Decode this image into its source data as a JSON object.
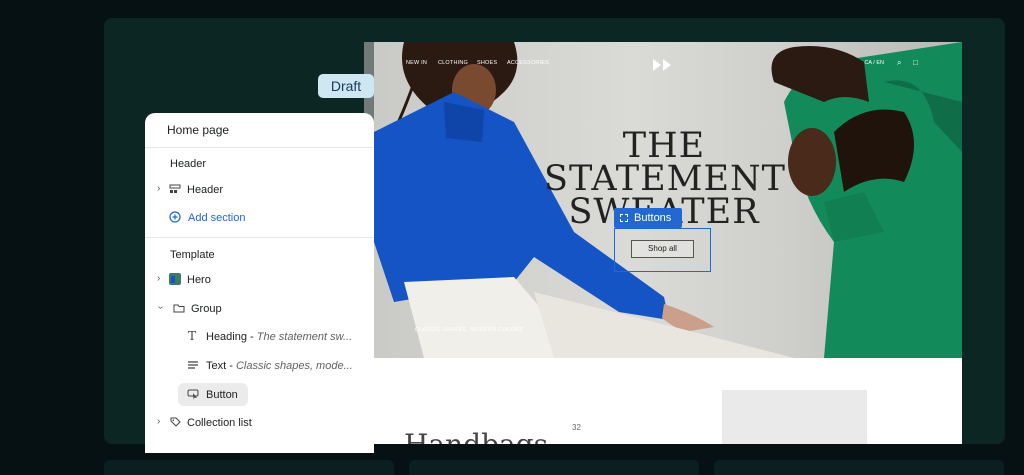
{
  "draft_label": "Draft",
  "sidebar": {
    "title": "Home page",
    "header_section": "Header",
    "header_item": "Header",
    "add_section": "Add section",
    "template_section": "Template",
    "hero": "Hero",
    "group": "Group",
    "heading_label": "Heading -",
    "heading_detail": "The statement sw...",
    "text_label": "Text -",
    "text_detail": "Classic shapes, mode...",
    "button": "Button",
    "collection_list": "Collection list"
  },
  "preview": {
    "nav": [
      "NEW IN",
      "CLOTHING",
      "SHOES",
      "ACCESSORIES"
    ],
    "locale": "CA / EN",
    "headline": [
      "THE",
      "STATEMENT",
      "SWEATER"
    ],
    "subtext": "CLASSIC SHAPES, MODERN COLORS",
    "shop_button": "Shop all",
    "selection_tag": "Buttons",
    "lower_heading": "Handbags",
    "lower_count": "32"
  },
  "colors": {
    "accent": "#2367d1",
    "draft_bg": "#cfe6f3",
    "frame_bg": "#0c2624",
    "sweater_blue": "#1554c4",
    "sweater_green": "#138a5a"
  }
}
